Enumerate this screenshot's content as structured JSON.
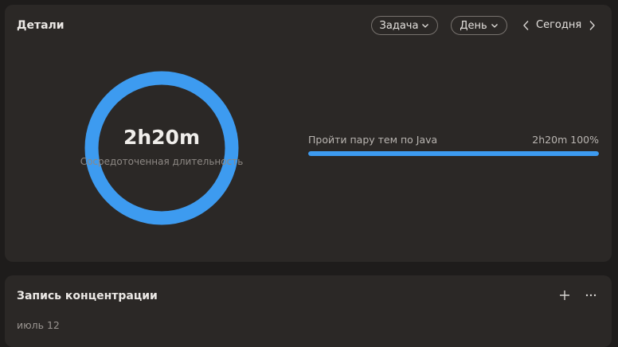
{
  "details": {
    "title": "Детали",
    "task_filter": "Задача",
    "period_filter": "День",
    "date_label": "Сегодня",
    "summary": {
      "total": "2h20m",
      "caption": "Сосредоточенная длительность",
      "ring_fraction": 1.0,
      "ring_color": "#3d9bf0"
    },
    "tasks": [
      {
        "name": "Пройти пару тем по Java",
        "duration": "2h20m",
        "percent": "100%",
        "fraction": 1.0
      }
    ]
  },
  "focus_log": {
    "title": "Запись концентрации",
    "date": "июль 12"
  },
  "icons": {
    "filter_chevron": "chevron-down-icon",
    "prev": "chevron-left-icon",
    "next": "chevron-right-icon",
    "add": "plus-icon",
    "more": "ellipsis-icon"
  },
  "colors": {
    "background": "#1e1c1b",
    "card": "#2b2826",
    "accent": "#3d9bf0"
  }
}
